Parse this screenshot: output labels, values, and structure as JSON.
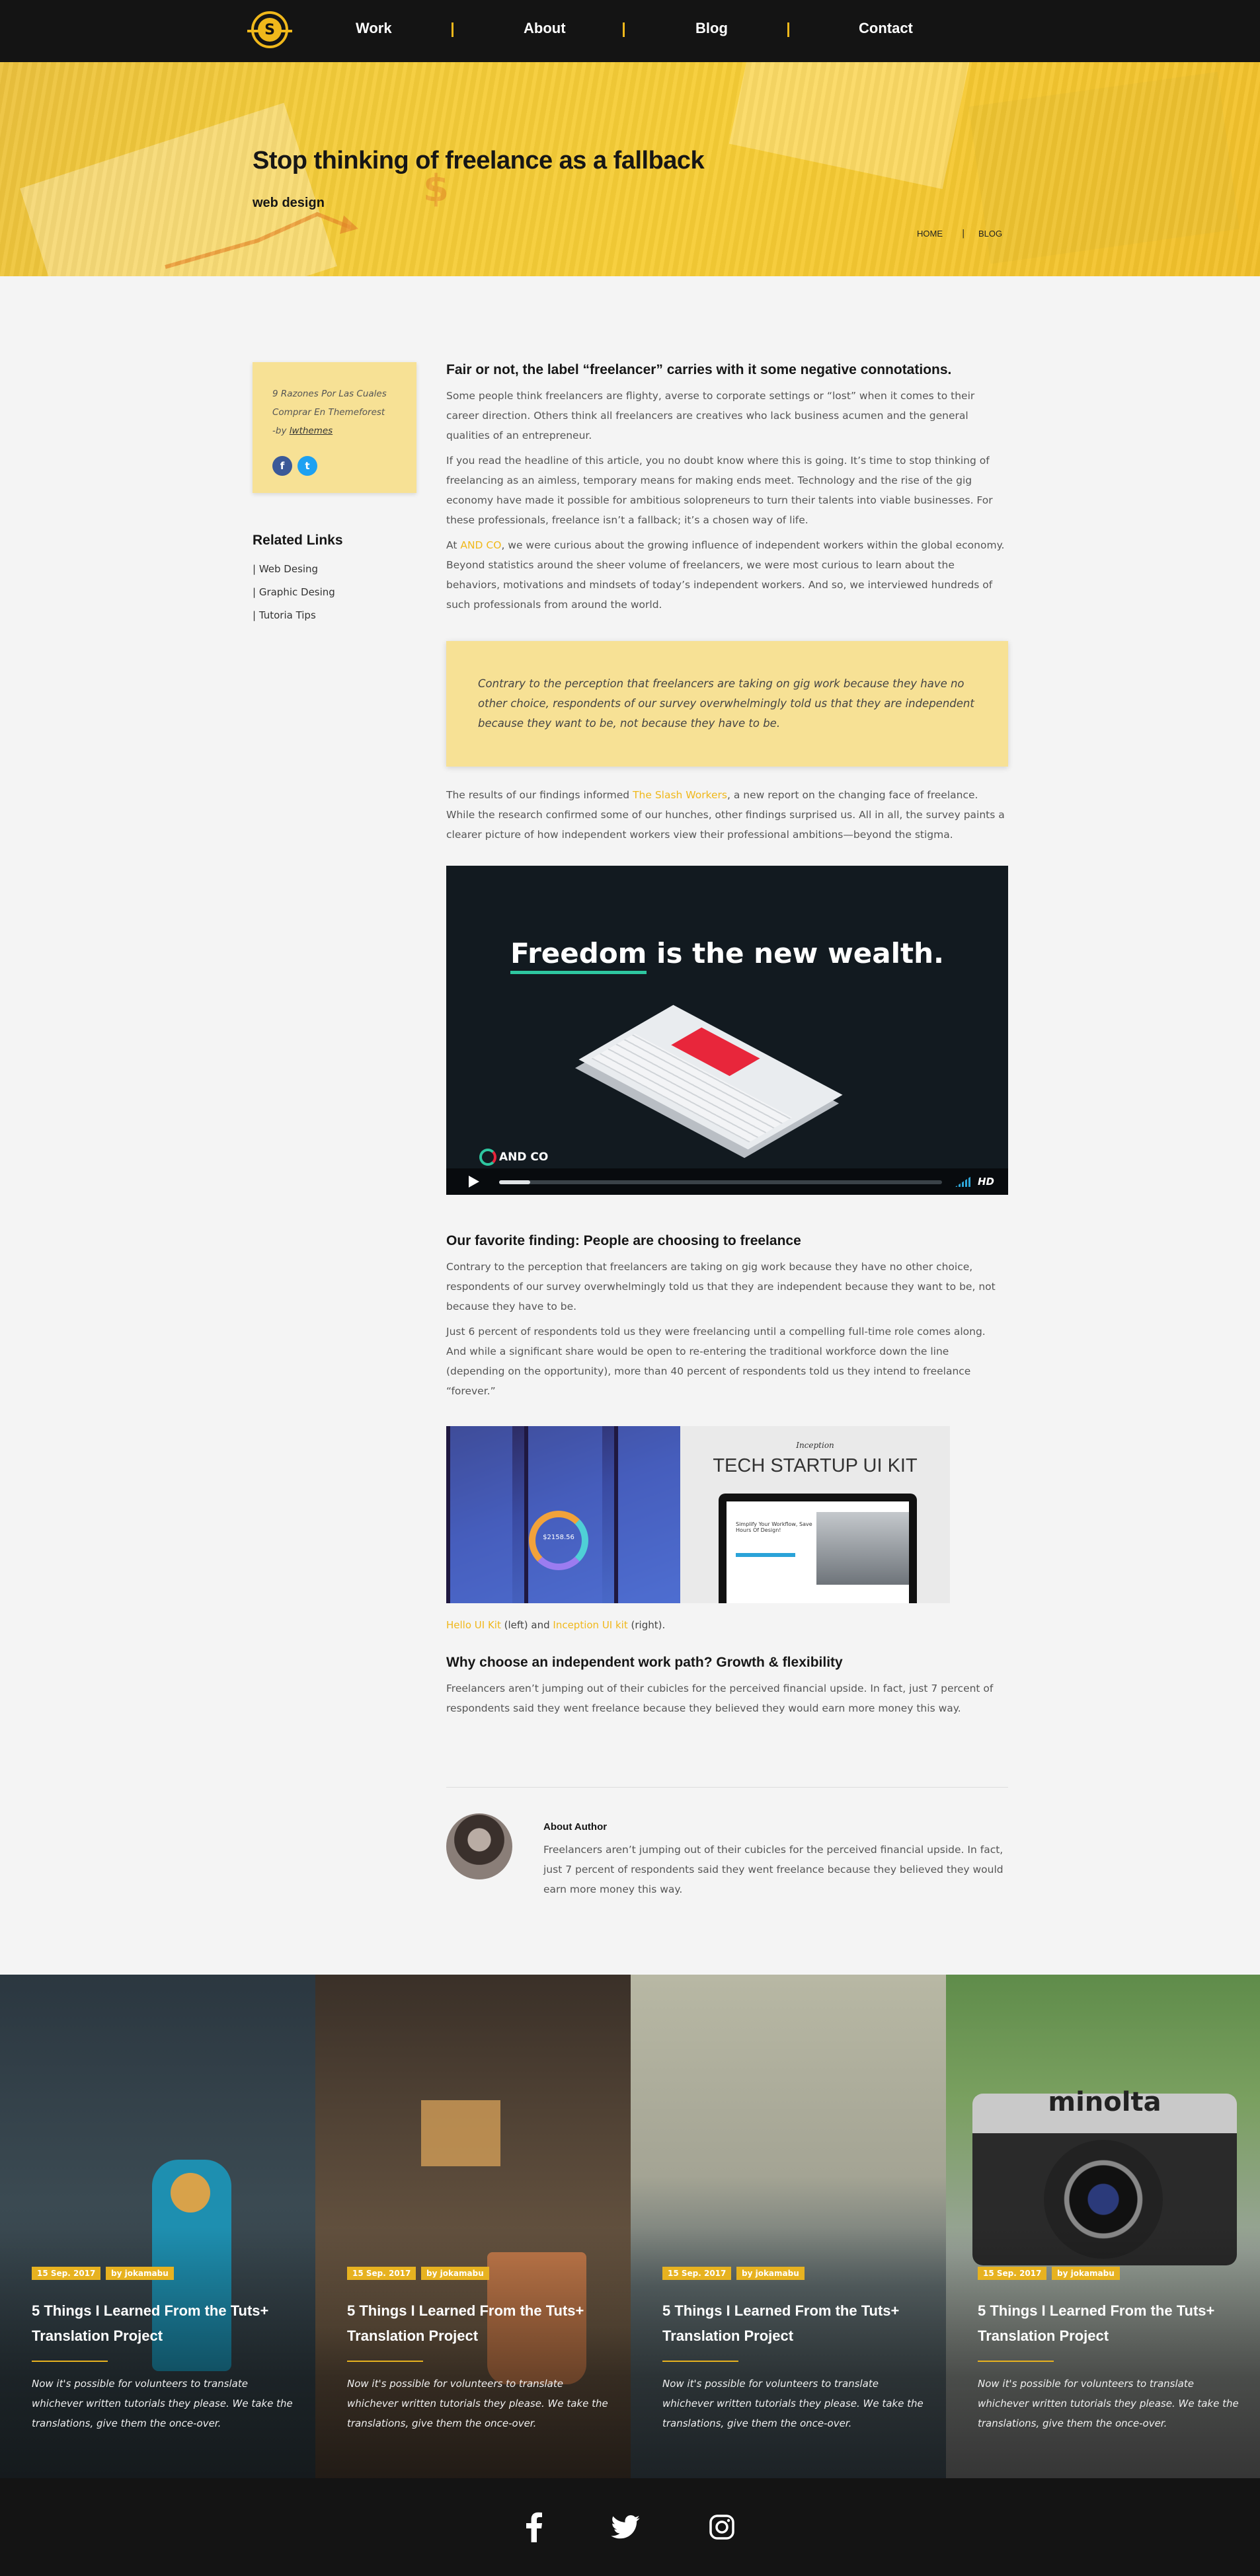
{
  "nav": {
    "logo_letter": "S",
    "items": [
      {
        "label": "Work"
      },
      {
        "label": "About"
      },
      {
        "label": "Blog"
      },
      {
        "label": "Contact"
      }
    ]
  },
  "hero": {
    "title": "Stop thinking of freelance as a fallback",
    "subtitle": "web design",
    "breadcrumb": {
      "home": "HOME",
      "separator": "|",
      "blog": "BLOG"
    }
  },
  "sidebar": {
    "meta_line1": "9 Razones Por Las Cuales",
    "meta_line2": "Comprar En Themeforest",
    "by": "-by ",
    "author": "lwthemes",
    "social": [
      {
        "icon": "facebook-icon",
        "glyph": "f"
      },
      {
        "icon": "twitter-icon",
        "glyph": "t"
      }
    ],
    "related_heading": "Related Links",
    "related": [
      "| Web Desing",
      "| Graphic Desing",
      "| Tutoria Tips"
    ]
  },
  "article": {
    "heading1": "Fair or not, the label “freelancer” carries with it some negative connotations.",
    "para1": "Some people think freelancers are flighty, averse to corporate settings or “lost” when it comes to their career direction. Others think all freelancers are creatives who lack business acumen and the general qualities of an entrepreneur.",
    "para2": "If you read the headline of this article, you no doubt know where this is going. It’s time to stop thinking of freelancing as an aimless, temporary means for making ends meet. Technology and the rise of the gig economy have made it possible for ambitious solopreneurs to turn their talents into viable businesses. For these professionals, freelance isn’t a fallback; it’s a chosen way of life.",
    "para3_pre": "At ",
    "para3_link": "AND CO",
    "para3_post": ", we were curious about the growing influence of independent workers within the global economy. Beyond statistics around the sheer volume of freelancers, we were most curious to learn about the behaviors, motivations and mindsets of today’s independent workers. And so, we interviewed hundreds of such professionals from around the world.",
    "quote": "Contrary to the perception that freelancers are taking on gig work because they have no other choice, respondents of our survey overwhelmingly told us that they are independent because they want to be, not because they have to be.",
    "para4_pre": "The results of our findings informed ",
    "para4_link": "The Slash Workers",
    "para4_post": ", a new report on the changing face of freelance. While the research confirmed some of our hunches, other findings surprised us. All in all, the survey paints a clearer picture of how independent workers view their professional ambitions—beyond the stigma.",
    "video": {
      "headline_highlight": "Freedom",
      "headline_rest": " is the new wealth.",
      "brand": "AND CO",
      "hd": "HD",
      "progress": 0.07
    },
    "heading2": "Our favorite finding: People are choosing to freelance",
    "para5": "Contrary to the perception that freelancers are taking on gig work because they have no other choice, respondents of our survey overwhelmingly told us that they are independent because they want to be, not because they have to be.",
    "para6": "Just 6 percent of respondents told us they were freelancing until a compelling full-time role comes along. And while a significant share would be open to re-entering the traditional workforce down the line (depending on the opportunity), more than 40 percent of respondents told us they intend to freelance “forever.”",
    "ui_kit_right": {
      "brand": "Inception",
      "title": "TECH STARTUP UI KIT",
      "screen_heading": "Simplify Your Workflow, Save Hours Of Design!"
    },
    "ui_kit_left": {
      "amount": "$2158.56"
    },
    "caption": {
      "link1": "Hello UI Kit",
      "mid": " (left) and ",
      "link2": "Inception UI kit",
      "end": " (right)."
    },
    "heading3": "Why choose an independent work path? Growth & flexibility",
    "para7": "Freelancers aren’t jumping out of their cubicles for the perceived financial upside. In fact, just 7 percent of respondents said they went freelance because they believed they would earn more money this way."
  },
  "author_box": {
    "heading": "About Author",
    "text": "Freelancers aren’t jumping out of their cubicles for the perceived financial upside. In fact, just 7 percent of respondents said they went freelance because they believed they would earn more money this way."
  },
  "cards": [
    {
      "date": "15 Sep. 2017",
      "author": "by jokamabu",
      "title": "5 Things I Learned From the Tuts+ Translation Project",
      "text": "Now it's possible for volunteers to translate whichever written tutorials they please. We take the translations, give them the once-over."
    },
    {
      "date": "15 Sep. 2017",
      "author": "by jokamabu",
      "title": "5 Things I Learned From the Tuts+ Translation Project",
      "text": "Now it's possible for volunteers to translate whichever written tutorials they please. We take the translations, give them the once-over."
    },
    {
      "date": "15 Sep. 2017",
      "author": "by jokamabu",
      "title": "5 Things I Learned From the Tuts+ Translation Project",
      "text": "Now it's possible for volunteers to translate whichever written tutorials they please. We take the translations, give them the once-over."
    },
    {
      "date": "15 Sep. 2017",
      "author": "by jokamabu",
      "title": "5 Things I Learned From the Tuts+ Translation Project",
      "text": "Now it's possible for volunteers to translate whichever written tutorials they please. We take the translations, give them the once-over."
    }
  ],
  "camera_brand": "minolta",
  "footer": {
    "icons": [
      "facebook-icon",
      "twitter-icon",
      "instagram-icon"
    ]
  },
  "colors": {
    "accent": "#f0b81b",
    "tag": "#e7b220",
    "dark": "#141414",
    "note_bg": "#f7e195"
  }
}
